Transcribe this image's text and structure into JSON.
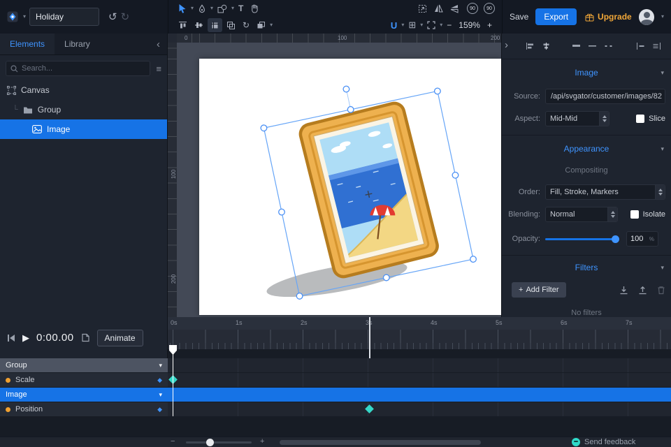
{
  "icons": {
    "caret_down": "▾",
    "chevron_left": "‹",
    "chevron_right": "›",
    "undo": "↺",
    "redo": "↻",
    "play": "▶",
    "sort": "≡",
    "grid": "⊞",
    "minus": "−",
    "plus": "+",
    "keyframe_diamond": "◆",
    "text_tool": "T"
  },
  "topbar": {
    "project_name": "Holiday",
    "save_label": "Save",
    "export_label": "Export",
    "upgrade_label": "Upgrade",
    "units_label": "U",
    "rotate_ccw": "90",
    "rotate_cw": "90",
    "zoom_level": "159%"
  },
  "left_panel": {
    "tabs": [
      {
        "label": "Elements",
        "active": true
      },
      {
        "label": "Library",
        "active": false
      }
    ],
    "search": {
      "placeholder": "Search..."
    },
    "tree": [
      {
        "label": "Canvas",
        "depth": 0
      },
      {
        "label": "Group",
        "depth": 1
      },
      {
        "label": "Image",
        "depth": 2,
        "selected": true
      }
    ]
  },
  "canvas": {
    "zoom_percent": 159,
    "ruler_top": [
      "0",
      "100",
      "200"
    ],
    "ruler_left": [
      "100",
      "200"
    ]
  },
  "right_panel": {
    "image_section": {
      "title": "Image",
      "source_label": "Source:",
      "source_value": "/api/svgator/customer/images/82",
      "aspect_label": "Aspect:",
      "aspect_value": "Mid-Mid",
      "slice_label": "Slice"
    },
    "appearance_section": {
      "title": "Appearance",
      "compositing_label": "Compositing",
      "order_label": "Order:",
      "order_value": "Fill, Stroke, Markers",
      "blending_label": "Blending:",
      "blending_value": "Normal",
      "isolate_label": "Isolate",
      "opacity_label": "Opacity:",
      "opacity_value": "100",
      "opacity_unit": "%"
    },
    "filters_section": {
      "title": "Filters",
      "add_filter_plus": "+",
      "add_filter_label": "Add Filter",
      "empty_text": "No filters"
    }
  },
  "timeline": {
    "current_time": "0:00.00",
    "animate_label": "Animate",
    "ruler_labels": [
      "0s",
      "1s",
      "2s",
      "3s",
      "4s",
      "5s",
      "6s",
      "7s"
    ],
    "tracks": [
      {
        "label": "Group",
        "type": "group"
      },
      {
        "label": "Scale",
        "type": "property",
        "keyframe_times": [
          "0s"
        ]
      },
      {
        "label": "Image",
        "type": "element",
        "selected": true
      },
      {
        "label": "Position",
        "type": "property",
        "keyframe_times": [
          "3s"
        ]
      }
    ],
    "feedback_label": "Send feedback"
  },
  "colors": {
    "accent_blue": "#1673e6",
    "upgrade_orange": "#f0a638",
    "keyframe_teal": "#35d8c8",
    "property_dot_orange": "#f0a030",
    "selection_blue": "#4a90f5"
  }
}
